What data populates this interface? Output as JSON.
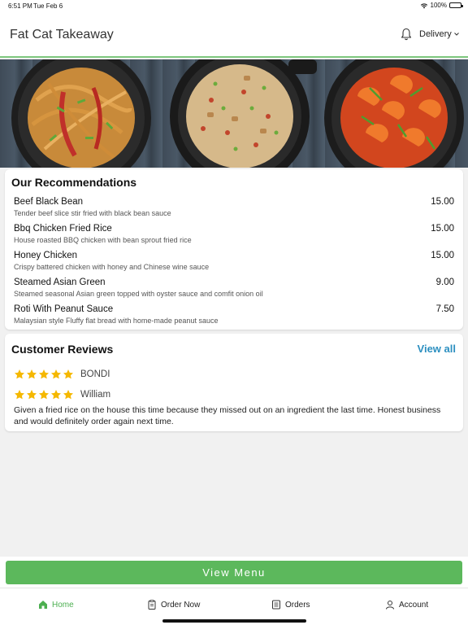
{
  "status_bar": {
    "time": "6:51 PM",
    "date": "Tue Feb 6",
    "battery": "100%"
  },
  "header": {
    "title": "Fat Cat Takeaway",
    "mode_label": "Delivery"
  },
  "recommendations": {
    "title": "Our Recommendations",
    "items": [
      {
        "name": "Beef Black Bean",
        "description": "Tender beef slice stir fried with black bean sauce",
        "price": "15.00"
      },
      {
        "name": "Bbq Chicken Fried Rice",
        "description": "House roasted BBQ chicken with bean sprout fried rice",
        "price": "15.00"
      },
      {
        "name": "Honey Chicken",
        "description": "Crispy battered chicken with honey and Chinese wine sauce",
        "price": "15.00"
      },
      {
        "name": "Steamed Asian Green",
        "description": "Steamed seasonal Asian green topped with oyster sauce and comfit onion oil",
        "price": "9.00"
      },
      {
        "name": "Roti With Peanut Sauce",
        "description": "Malaysian style Fluffy flat bread with home-made peanut sauce",
        "price": "7.50"
      }
    ]
  },
  "reviews": {
    "title": "Customer Reviews",
    "view_all_label": "View all",
    "items": [
      {
        "reviewer": "BONDI",
        "rating": 5
      },
      {
        "reviewer": "William",
        "rating": 5,
        "text": "Given a fried rice on the house this time because they missed out on an ingredient the last time. Honest business and would definitely order again next time."
      }
    ]
  },
  "cta": {
    "label": "View Menu"
  },
  "tabbar": {
    "tabs": [
      {
        "label": "Home",
        "icon": "home-icon",
        "active": true
      },
      {
        "label": "Order Now",
        "icon": "clipboard-icon",
        "active": false
      },
      {
        "label": "Orders",
        "icon": "receipt-icon",
        "active": false
      },
      {
        "label": "Account",
        "icon": "person-icon",
        "active": false
      }
    ]
  },
  "colors": {
    "accent_green": "#5cb85c",
    "link_blue": "#2c8fc0",
    "star_gold": "#f5b800"
  }
}
